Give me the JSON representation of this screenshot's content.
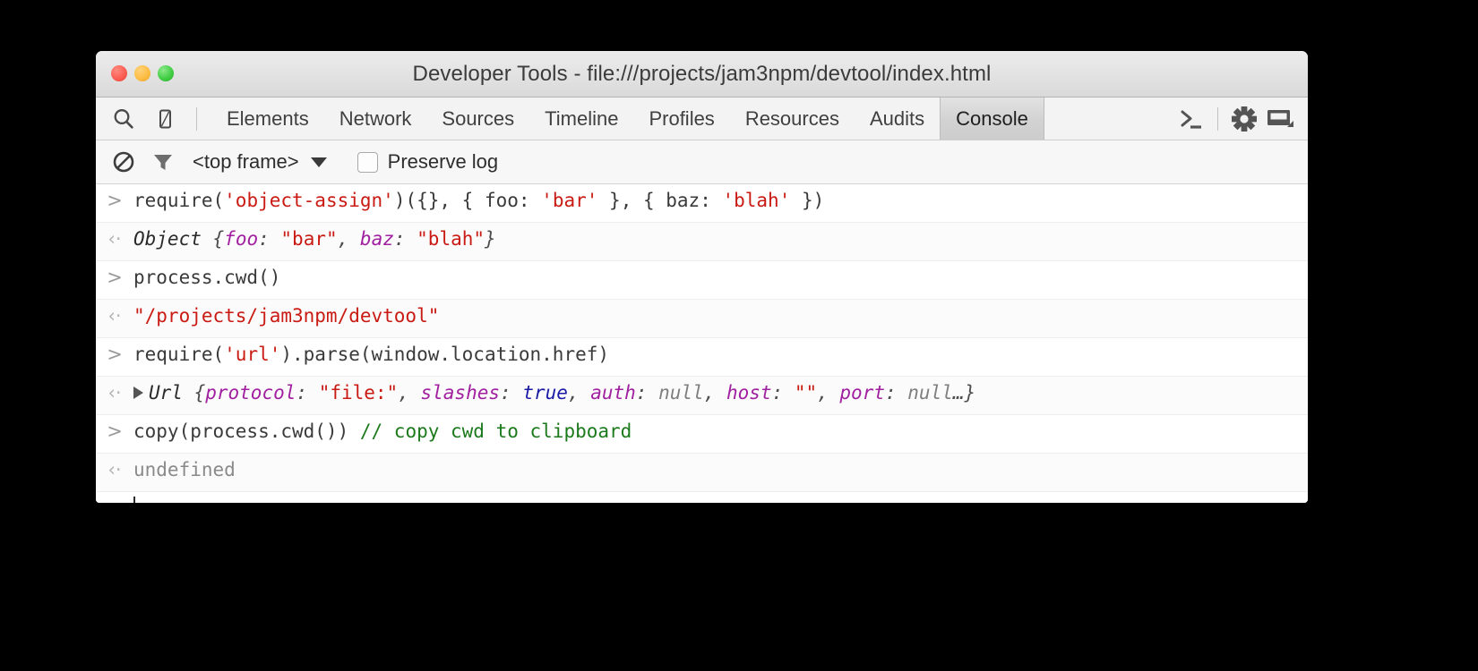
{
  "window": {
    "title": "Developer Tools - file:///projects/jam3npm/devtool/index.html",
    "traffic_lights": [
      "close",
      "minimize",
      "zoom"
    ]
  },
  "toolbar": {
    "left_icons": [
      {
        "name": "search-icon",
        "glyph": "search"
      },
      {
        "name": "device-mode-icon",
        "glyph": "device"
      }
    ],
    "tabs": [
      {
        "label": "Elements",
        "active": false
      },
      {
        "label": "Network",
        "active": false
      },
      {
        "label": "Sources",
        "active": false
      },
      {
        "label": "Timeline",
        "active": false
      },
      {
        "label": "Profiles",
        "active": false
      },
      {
        "label": "Resources",
        "active": false
      },
      {
        "label": "Audits",
        "active": false
      },
      {
        "label": "Console",
        "active": true
      }
    ],
    "right_icons": [
      {
        "name": "console-prompt-icon",
        "glyph": ">_"
      },
      {
        "name": "settings-gear-icon",
        "glyph": "gear"
      },
      {
        "name": "dock-side-icon",
        "glyph": "dock"
      }
    ]
  },
  "filterbar": {
    "clear_icon": "clear-console-icon",
    "filter_icon": "filter-funnel-icon",
    "frame_selector": "<top frame>",
    "preserve_log_label": "Preserve log",
    "preserve_log_checked": false
  },
  "console": {
    "rows": [
      {
        "kind": "input",
        "gutter": ">",
        "tokens": [
          {
            "t": "require(",
            "c": "plain"
          },
          {
            "t": "'object-assign'",
            "c": "str"
          },
          {
            "t": ")({}, { foo: ",
            "c": "plain"
          },
          {
            "t": "'bar'",
            "c": "str"
          },
          {
            "t": " }, { baz: ",
            "c": "plain"
          },
          {
            "t": "'blah'",
            "c": "str"
          },
          {
            "t": " })",
            "c": "plain"
          }
        ]
      },
      {
        "kind": "output",
        "gutter": "‹·",
        "tokens": [
          {
            "t": "Object ",
            "c": "ctor"
          },
          {
            "t": "{",
            "c": "out"
          },
          {
            "t": "foo",
            "c": "prop"
          },
          {
            "t": ": ",
            "c": "out"
          },
          {
            "t": "\"bar\"",
            "c": "str"
          },
          {
            "t": ", ",
            "c": "out"
          },
          {
            "t": "baz",
            "c": "prop"
          },
          {
            "t": ": ",
            "c": "out"
          },
          {
            "t": "\"blah\"",
            "c": "str"
          },
          {
            "t": "}",
            "c": "out"
          }
        ]
      },
      {
        "kind": "input",
        "gutter": ">",
        "tokens": [
          {
            "t": "process.cwd()",
            "c": "plain"
          }
        ]
      },
      {
        "kind": "output",
        "gutter": "‹·",
        "tokens": [
          {
            "t": "\"/projects/jam3npm/devtool\"",
            "c": "str"
          }
        ]
      },
      {
        "kind": "input",
        "gutter": ">",
        "tokens": [
          {
            "t": "require(",
            "c": "plain"
          },
          {
            "t": "'url'",
            "c": "str"
          },
          {
            "t": ").parse(window.location.href)",
            "c": "plain"
          }
        ]
      },
      {
        "kind": "output",
        "gutter": "‹·",
        "disclosure": true,
        "tokens": [
          {
            "t": "Url ",
            "c": "ctor"
          },
          {
            "t": "{",
            "c": "out"
          },
          {
            "t": "protocol",
            "c": "prop"
          },
          {
            "t": ": ",
            "c": "out"
          },
          {
            "t": "\"file:\"",
            "c": "str"
          },
          {
            "t": ", ",
            "c": "out"
          },
          {
            "t": "slashes",
            "c": "prop"
          },
          {
            "t": ": ",
            "c": "out"
          },
          {
            "t": "true",
            "c": "bool"
          },
          {
            "t": ", ",
            "c": "out"
          },
          {
            "t": "auth",
            "c": "prop"
          },
          {
            "t": ": ",
            "c": "out"
          },
          {
            "t": "null",
            "c": "null"
          },
          {
            "t": ", ",
            "c": "out"
          },
          {
            "t": "host",
            "c": "prop"
          },
          {
            "t": ": ",
            "c": "out"
          },
          {
            "t": "\"\"",
            "c": "str"
          },
          {
            "t": ", ",
            "c": "out"
          },
          {
            "t": "port",
            "c": "prop"
          },
          {
            "t": ": ",
            "c": "out"
          },
          {
            "t": "null",
            "c": "null"
          },
          {
            "t": "…}",
            "c": "out"
          }
        ]
      },
      {
        "kind": "input",
        "gutter": ">",
        "tokens": [
          {
            "t": "copy(process.cwd()) ",
            "c": "plain"
          },
          {
            "t": "// copy cwd to clipboard",
            "c": "cmt"
          }
        ]
      },
      {
        "kind": "output",
        "gutter": "‹·",
        "tokens": [
          {
            "t": "undefined",
            "c": "undef"
          }
        ]
      },
      {
        "kind": "prompt",
        "gutter": ">",
        "tokens": []
      }
    ]
  }
}
